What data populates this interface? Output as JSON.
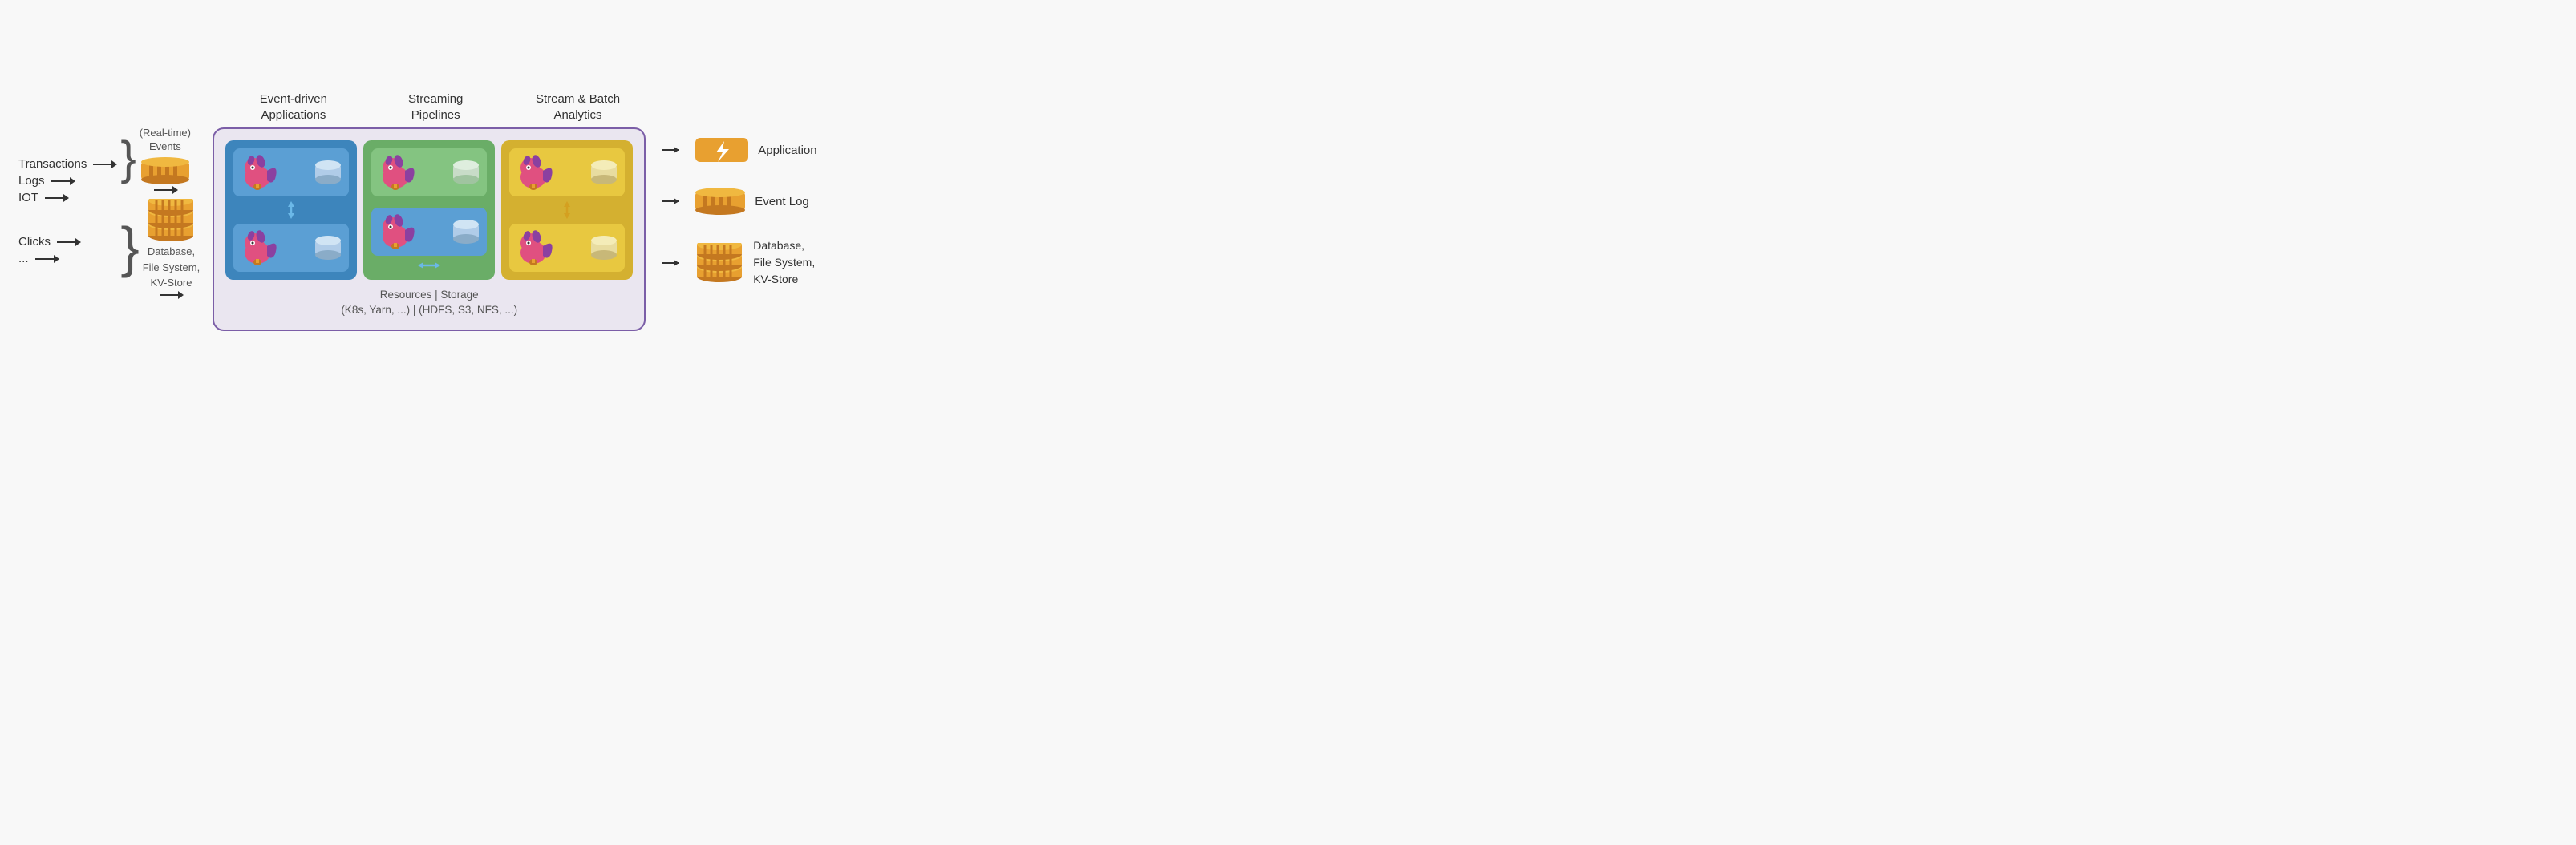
{
  "sources": {
    "items": [
      "Transactions",
      "Logs",
      "IOT",
      "Clicks",
      "..."
    ]
  },
  "events_label": "(Real-time)\nEvents",
  "db_label": "Database,\nFile System,\nKV-Store",
  "column_headers": [
    {
      "label": "Event-driven\nApplications"
    },
    {
      "label": "Streaming\nPipelines"
    },
    {
      "label": "Stream & Batch\nAnalytics"
    }
  ],
  "footer_text": "Resources | Storage\n(K8s, Yarn, ...) | (HDFS, S3, NFS, ...)",
  "outputs": [
    {
      "label": "Application"
    },
    {
      "label": "Event Log"
    },
    {
      "label": "Database,\nFile System,\nKV-Store"
    }
  ],
  "colors": {
    "border": "#7b5ea7",
    "blue": "#4a90c4",
    "green": "#7db87a",
    "yellow": "#e8c840",
    "orange": "#e8a030"
  }
}
